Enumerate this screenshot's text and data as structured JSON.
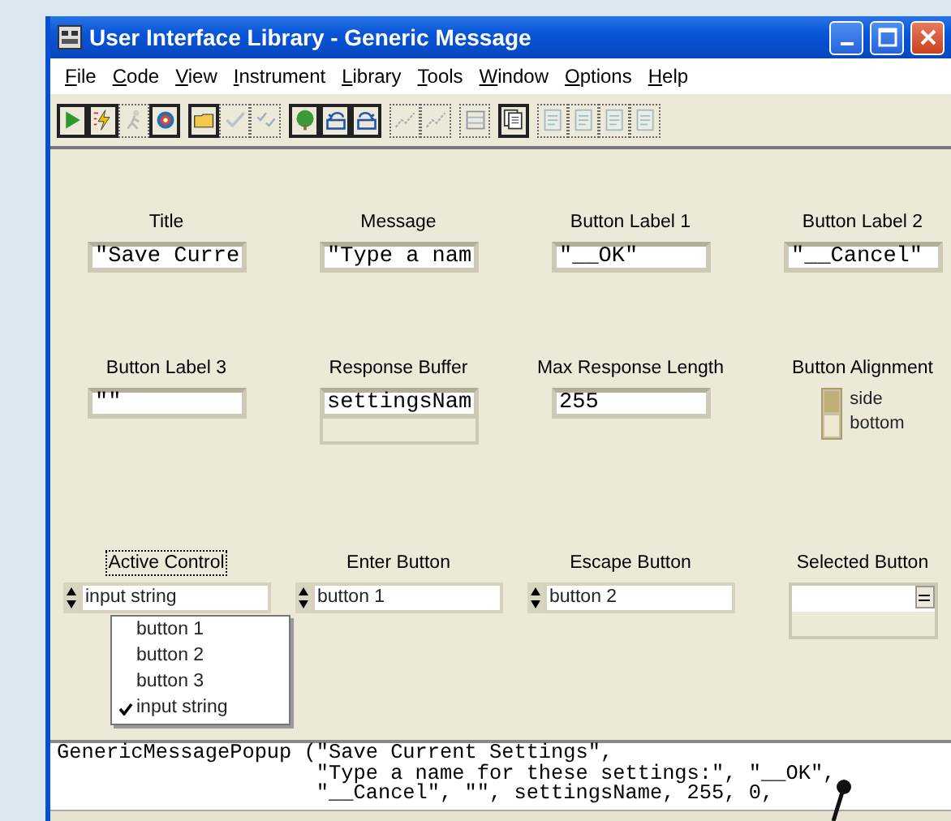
{
  "window": {
    "title": "User Interface Library - Generic Message"
  },
  "menu": [
    "File",
    "Code",
    "View",
    "Instrument",
    "Library",
    "Tools",
    "Window",
    "Options",
    "Help"
  ],
  "toolbar": [
    [
      {
        "disabled": false
      },
      {
        "disabled": false
      },
      {
        "disabled": true
      },
      {
        "disabled": false
      }
    ],
    [
      {
        "disabled": false
      },
      {
        "disabled": true
      },
      {
        "disabled": true
      }
    ],
    [
      {
        "disabled": false
      },
      {
        "disabled": false
      },
      {
        "disabled": false
      }
    ],
    [
      {
        "disabled": true
      },
      {
        "disabled": true
      }
    ],
    [
      {
        "disabled": true
      }
    ],
    [
      {
        "disabled": false
      }
    ],
    [
      {
        "disabled": true
      },
      {
        "disabled": true
      },
      {
        "disabled": true
      },
      {
        "disabled": true
      }
    ]
  ],
  "fields_row_1": [
    {
      "label": "Title",
      "value": "\"Save Curre"
    },
    {
      "label": "Message",
      "value": "\"Type a nam"
    },
    {
      "label": "Button Label 1",
      "value": "\"__OK\""
    },
    {
      "label": "Button Label 2",
      "value": "\"__Cancel\""
    }
  ],
  "fields_row_2": [
    {
      "label": "Button Label 3",
      "value": "\"\""
    },
    {
      "label": "Response Buffer",
      "value": "settingsNam"
    },
    {
      "label": "Max Response Length",
      "value": "255"
    }
  ],
  "button_alignment": {
    "label": "Button Alignment",
    "options": [
      {
        "label": "side",
        "selected": true
      },
      {
        "label": "bottom",
        "selected": false
      }
    ]
  },
  "rings": [
    {
      "label": "Active Control",
      "value": "input string",
      "focused": true
    },
    {
      "label": "Enter Button",
      "value": "button 1",
      "focused": false
    },
    {
      "label": "Escape Button",
      "value": "button 2",
      "focused": false
    }
  ],
  "active_control_menu": [
    {
      "label": "button 1",
      "checked": false
    },
    {
      "label": "button 2",
      "checked": false
    },
    {
      "label": "button 3",
      "checked": false
    },
    {
      "label": "input string",
      "checked": true
    }
  ],
  "selected_button": {
    "label": "Selected Button"
  },
  "code_lines": [
    "GenericMessagePopup (\"Save Current Settings\",",
    "                     \"Type a name for these settings:\", \"__OK\",",
    "                     \"__Cancel\", \"\", settingsName, 255, 0,"
  ]
}
